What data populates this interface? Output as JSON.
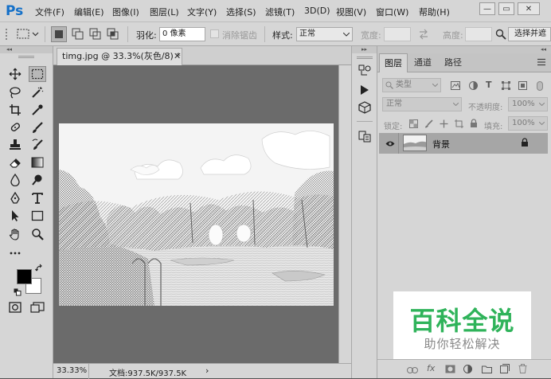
{
  "app": {
    "logo": "Ps"
  },
  "menu": [
    "文件(F)",
    "编辑(E)",
    "图像(I)",
    "图层(L)",
    "文字(Y)",
    "选择(S)",
    "滤镜(T)",
    "3D(D)",
    "视图(V)",
    "窗口(W)",
    "帮助(H)"
  ],
  "window_controls": {
    "minimize": "—",
    "restore": "▭",
    "close": "✕"
  },
  "options": {
    "feather_label": "羽化:",
    "feather_value": "0 像素",
    "antialias_label": "消除锯齿",
    "style_label": "样式:",
    "style_value": "正常",
    "width_label": "宽度:",
    "height_label": "高度:",
    "select_mask_button": "选择并遮"
  },
  "document": {
    "tab_title": "timg.jpg @ 33.3%(灰色/8) *",
    "tab_close": "✕",
    "zoom": "33.33%",
    "doc_info": "文档:937.5K/937.5K",
    "status_arrow": "›"
  },
  "layers_panel": {
    "tabs": [
      "图层",
      "通道",
      "路径"
    ],
    "filter_kind": "类型",
    "blend_mode": "正常",
    "opacity_label": "不透明度:",
    "opacity_value": "100%",
    "lock_label": "锁定:",
    "fill_label": "填充:",
    "fill_value": "100%",
    "layer_name": "背景"
  },
  "watermark": {
    "title": "百科全说",
    "subtitle": "助你轻松解决"
  },
  "colors": {
    "ps_blue": "#1470c8",
    "watermark_green": "#2fb35a"
  }
}
